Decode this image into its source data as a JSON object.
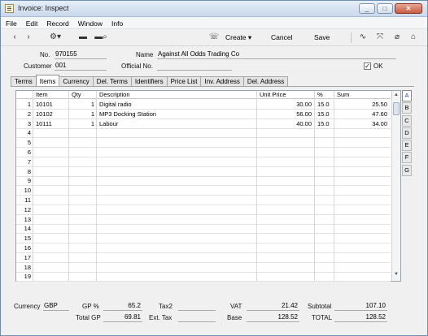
{
  "window": {
    "title": "Invoice: Inspect"
  },
  "menu": [
    "File",
    "Edit",
    "Record",
    "Window",
    "Info"
  ],
  "toolbar": {
    "create": "Create",
    "cancel": "Cancel",
    "save": "Save"
  },
  "header": {
    "no_label": "No.",
    "no_value": "970155",
    "name_label": "Name",
    "name_value": "Against All Odds Trading Co",
    "customer_label": "Customer",
    "customer_value": "001",
    "official_label": "Official No.",
    "official_value": "",
    "ok_label": "OK",
    "ok_checked": "✓"
  },
  "tabs": [
    "Terms",
    "Items",
    "Currency",
    "Del. Terms",
    "Identifiers",
    "Price List",
    "Inv. Address",
    "Del. Address"
  ],
  "grid": {
    "columns": [
      "Item",
      "Qty",
      "Description",
      "Unit Price",
      "%",
      "Sum"
    ],
    "rows": [
      {
        "n": "1",
        "item": "10101",
        "qty": "1",
        "desc": "Digital radio",
        "price": "30.00",
        "pct": "15.0",
        "sum": "25.50"
      },
      {
        "n": "2",
        "item": "10102",
        "qty": "1",
        "desc": "MP3 Docking Station",
        "price": "56.00",
        "pct": "15.0",
        "sum": "47.60"
      },
      {
        "n": "3",
        "item": "10111",
        "qty": "1",
        "desc": "Labour",
        "price": "40.00",
        "pct": "15.0",
        "sum": "34.00"
      },
      {
        "n": "4"
      },
      {
        "n": "5"
      },
      {
        "n": "6"
      },
      {
        "n": "7"
      },
      {
        "n": "8"
      },
      {
        "n": "9"
      },
      {
        "n": "10"
      },
      {
        "n": "11"
      },
      {
        "n": "12"
      },
      {
        "n": "13"
      },
      {
        "n": "14"
      },
      {
        "n": "15"
      },
      {
        "n": "16"
      },
      {
        "n": "17"
      },
      {
        "n": "18"
      },
      {
        "n": "19"
      }
    ]
  },
  "cards": [
    "A",
    "B",
    "C",
    "D",
    "E",
    "F",
    "G"
  ],
  "footer": {
    "currency_label": "Currency",
    "currency_value": "GBP",
    "gp_pct_label": "GP %",
    "gp_pct_value": "65.2",
    "total_gp_label": "Total GP",
    "total_gp_value": "69.81",
    "tax2_label": "Tax2",
    "tax2_value": "",
    "ext_tax_label": "Ext. Tax",
    "ext_tax_value": "",
    "vat_label": "VAT",
    "vat_value": "21.42",
    "base_label": "Base",
    "base_value": "128.52",
    "subtotal_label": "Subtotal",
    "subtotal_value": "107.10",
    "total_label": "TOTAL",
    "total_value": "128.52"
  }
}
